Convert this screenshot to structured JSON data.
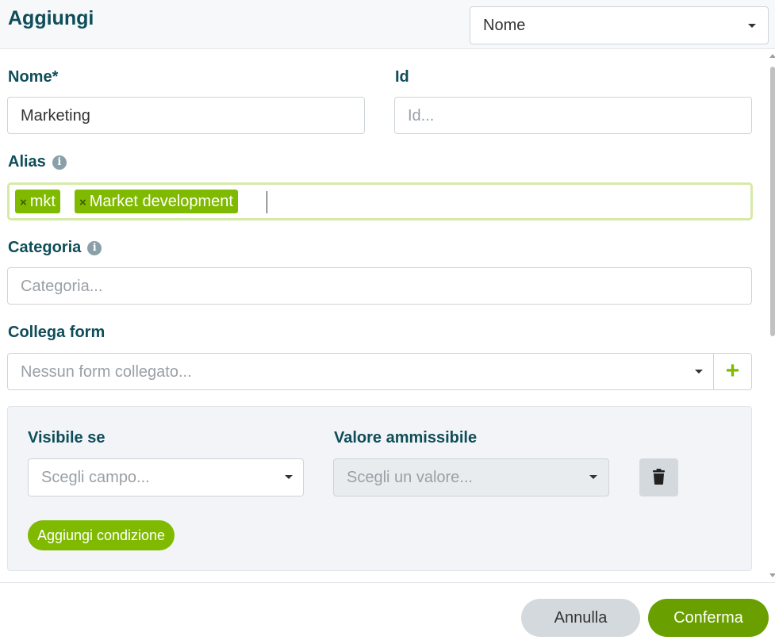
{
  "header": {
    "title": "Aggiungi",
    "select_value": "Nome"
  },
  "form": {
    "nome": {
      "label": "Nome*",
      "value": "Marketing"
    },
    "id": {
      "label": "Id",
      "placeholder": "Id..."
    },
    "alias": {
      "label": "Alias",
      "tags": [
        "mkt",
        "Market development"
      ]
    },
    "categoria": {
      "label": "Categoria",
      "placeholder": "Categoria..."
    },
    "collega_form": {
      "label": "Collega form",
      "placeholder": "Nessun form collegato...",
      "add_symbol": "+"
    }
  },
  "condition": {
    "visible_label": "Visibile se",
    "field_placeholder": "Scegli campo...",
    "value_label": "Valore ammissibile",
    "value_placeholder": "Scegli un valore...",
    "add_label": "Aggiungi condizione"
  },
  "footer": {
    "cancel_label": "Annulla",
    "confirm_label": "Conferma"
  },
  "icons": {
    "info": "info-icon",
    "trash": "trash-icon",
    "tag_remove": "close-icon"
  },
  "colors": {
    "accent": "#80ba00",
    "title": "#0e4d59",
    "confirm": "#6a9f00"
  }
}
